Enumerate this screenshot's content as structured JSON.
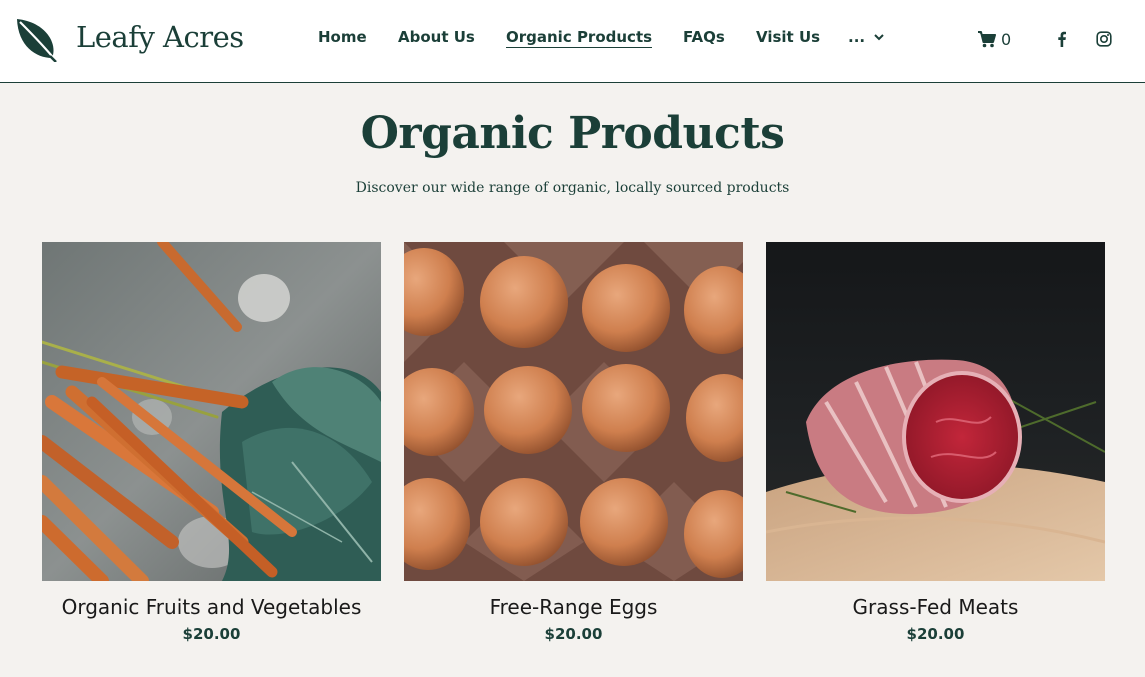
{
  "brand": {
    "name": "Leafy Acres",
    "logo_icon": "leaf-icon"
  },
  "nav": {
    "items": [
      {
        "label": "Home",
        "active": false
      },
      {
        "label": "About Us",
        "active": false
      },
      {
        "label": "Organic Products",
        "active": true
      },
      {
        "label": "FAQs",
        "active": false
      },
      {
        "label": "Visit Us",
        "active": false
      }
    ],
    "more_label": "...",
    "more_icon": "chevron-down-icon"
  },
  "cart": {
    "icon": "cart-icon",
    "count": "0"
  },
  "social": [
    {
      "icon": "facebook-icon"
    },
    {
      "icon": "instagram-icon"
    }
  ],
  "page": {
    "title": "Organic Products",
    "subtitle": "Discover our wide range of organic, locally sourced products"
  },
  "products": [
    {
      "name": "Organic Fruits and Vegetables",
      "price": "$20.00",
      "image": "carrots-and-greens-photo"
    },
    {
      "name": "Free-Range Eggs",
      "price": "$20.00",
      "image": "eggs-in-carton-photo"
    },
    {
      "name": "Grass-Fed Meats",
      "price": "$20.00",
      "image": "beef-roast-photo"
    }
  ],
  "colors": {
    "primary": "#1b3f38",
    "background": "#f4f2ef",
    "header": "#ffffff"
  }
}
